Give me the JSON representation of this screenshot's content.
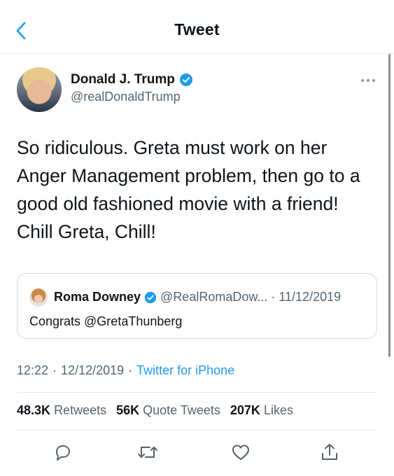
{
  "header": {
    "title": "Tweet",
    "back_icon": "chevron-left-icon"
  },
  "author": {
    "name": "Donald J. Trump",
    "handle": "@realDonaldTrump",
    "verified": true
  },
  "tweet": {
    "text": "So ridiculous. Greta must work on her Anger Management problem, then go to a good old fashioned movie with a friend! Chill Greta, Chill!"
  },
  "quote": {
    "name": "Roma Downey",
    "handle": "@RealRomaDow...",
    "date": "· 11/12/2019",
    "text": "Congrats @GretaThunberg"
  },
  "meta": {
    "time": "12:22",
    "date": "12/12/2019",
    "sep1": "·",
    "sep2": "·",
    "source": "Twitter for iPhone"
  },
  "stats": {
    "retweets_count": "48.3K",
    "retweets_label": "Retweets",
    "quotes_count": "56K",
    "quotes_label": "Quote Tweets",
    "likes_count": "207K",
    "likes_label": "Likes"
  },
  "colors": {
    "accent": "#1d9bf0",
    "secondary_text": "#536471",
    "border": "#cfd9de"
  }
}
